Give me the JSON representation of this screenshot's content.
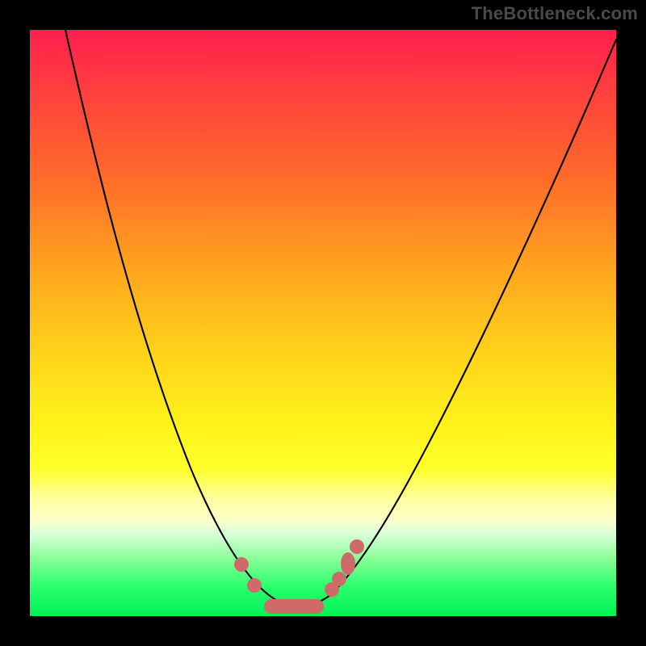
{
  "watermark": "TheBottleneck.com",
  "colors": {
    "gradient_top": "#ff1f4e",
    "gradient_mid": "#ffd21a",
    "gradient_bottom": "#00f257",
    "curve": "#000000",
    "markers": "#cf6a6a",
    "frame": "#000000"
  },
  "chart_data": {
    "type": "line",
    "title": "",
    "xlabel": "",
    "ylabel": "",
    "xlim": [
      0,
      100
    ],
    "ylim": [
      0,
      100
    ],
    "grid": false,
    "legend": false,
    "series": [
      {
        "name": "bottleneck-curve",
        "x": [
          6,
          12,
          18,
          24,
          28,
          32,
          36,
          40,
          44,
          48,
          51,
          54,
          58,
          64,
          72,
          80,
          90,
          100
        ],
        "values": [
          100,
          82,
          66,
          48,
          36,
          25,
          14,
          6,
          2,
          1,
          1,
          4,
          10,
          22,
          40,
          58,
          80,
          98
        ]
      }
    ],
    "markers": {
      "name": "highlight-points",
      "x": [
        36,
        38,
        40,
        42,
        44,
        46,
        48,
        51,
        52.5,
        54,
        56
      ],
      "values": [
        9,
        5,
        2,
        1.5,
        1,
        1,
        1.2,
        4.5,
        6.5,
        9,
        12
      ]
    },
    "background_gradient": {
      "direction": "vertical",
      "stops": [
        {
          "pos": 0,
          "color": "#ff1f4e"
        },
        {
          "pos": 40,
          "color": "#ffa21f"
        },
        {
          "pos": 68,
          "color": "#fff41a"
        },
        {
          "pos": 86,
          "color": "#d9ffd9"
        },
        {
          "pos": 100,
          "color": "#00f257"
        }
      ]
    }
  }
}
